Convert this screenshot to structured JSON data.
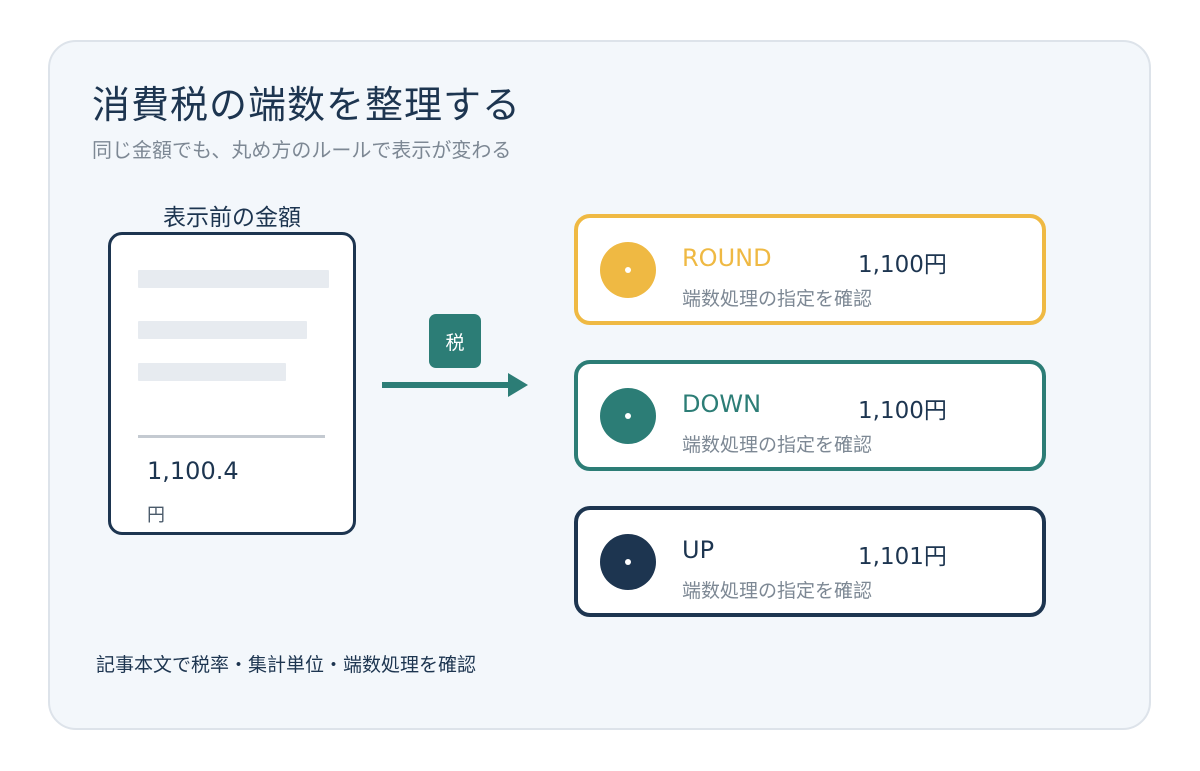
{
  "header": {
    "title": "消費税の端数を整理する",
    "subtitle": "同じ金額でも、丸め方のルールで表示が変わる"
  },
  "receipt": {
    "label": "表示前の金額",
    "amount": "1,100.4",
    "unit": "円"
  },
  "tax_badge": "税",
  "results": [
    {
      "mode": "ROUND",
      "value": "1,100円",
      "note": "端数処理の指定を確認",
      "color": "#efb943"
    },
    {
      "mode": "DOWN",
      "value": "1,100円",
      "note": "端数処理の指定を確認",
      "color": "#2c7d76"
    },
    {
      "mode": "UP",
      "value": "1,101円",
      "note": "端数処理の指定を確認",
      "color": "#1d3550"
    }
  ],
  "footer": "記事本文で税率・集計単位・端数処理を確認",
  "colors": {
    "navy": "#1d3550",
    "teal": "#2c7d76",
    "gold": "#efb943",
    "panel": "#f3f7fb"
  }
}
